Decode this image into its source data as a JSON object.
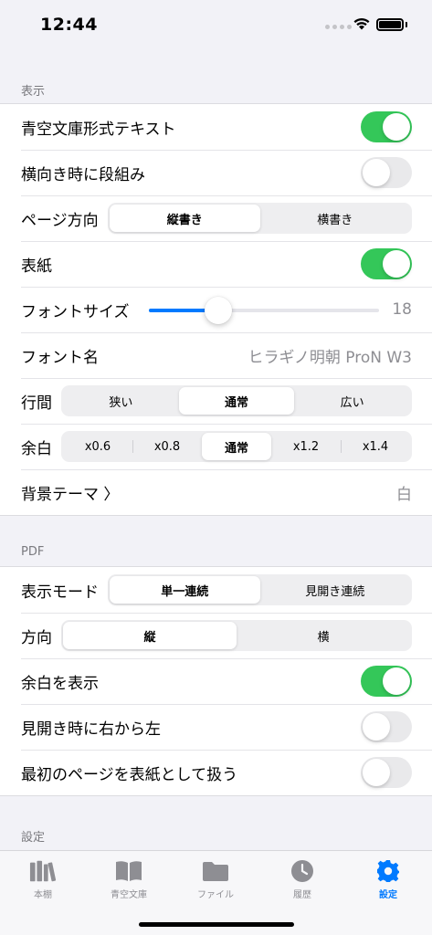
{
  "status_bar": {
    "time": "12:44"
  },
  "sections": {
    "display": {
      "header": "表示",
      "aozora_text": {
        "label": "青空文庫形式テキスト",
        "on": true
      },
      "landscape_columns": {
        "label": "横向き時に段組み",
        "on": false
      },
      "page_direction": {
        "label": "ページ方向",
        "options": [
          "縦書き",
          "横書き"
        ],
        "selected": 0
      },
      "cover": {
        "label": "表紙",
        "on": true
      },
      "font_size": {
        "label": "フォントサイズ",
        "value": "18",
        "fraction": 0.3
      },
      "font_name": {
        "label": "フォント名",
        "value": "ヒラギノ明朝 ProN W3"
      },
      "line_spacing": {
        "label": "行間",
        "options": [
          "狭い",
          "通常",
          "広い"
        ],
        "selected": 1
      },
      "margin": {
        "label": "余白",
        "options": [
          "x0.6",
          "x0.8",
          "通常",
          "x1.2",
          "x1.4"
        ],
        "selected": 2
      },
      "background_theme": {
        "label": "背景テーマ 〉",
        "value": "白"
      }
    },
    "pdf": {
      "header": "PDF",
      "display_mode": {
        "label": "表示モード",
        "options": [
          "単一連続",
          "見開き連続"
        ],
        "selected": 0
      },
      "direction": {
        "label": "方向",
        "options": [
          "縦",
          "横"
        ],
        "selected": 0
      },
      "show_margin": {
        "label": "余白を表示",
        "on": true
      },
      "spread_rtl": {
        "label": "見開き時に右から左",
        "on": false
      },
      "first_page_cover": {
        "label": "最初のページを表紙として扱う",
        "on": false
      }
    },
    "settings": {
      "header": "設定"
    }
  },
  "tab_bar": {
    "items": [
      {
        "label": "本棚",
        "icon": "books-icon"
      },
      {
        "label": "青空文庫",
        "icon": "open-book-icon"
      },
      {
        "label": "ファイル",
        "icon": "folder-icon"
      },
      {
        "label": "履歴",
        "icon": "clock-icon"
      },
      {
        "label": "設定",
        "icon": "gear-icon"
      }
    ],
    "active_index": 4
  },
  "colors": {
    "accent": "#007aff",
    "toggle_on": "#34c759",
    "toggle_off": "#e9e9eb",
    "secondary_text": "#8e8e93"
  }
}
